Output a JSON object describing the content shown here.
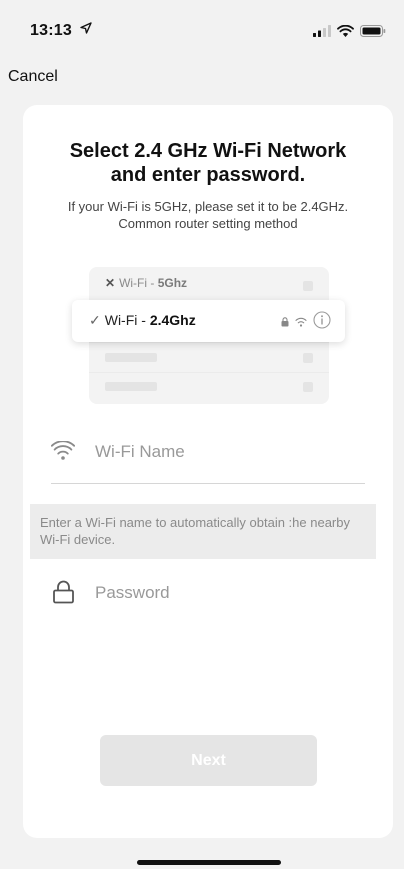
{
  "status_bar": {
    "time": "13:13",
    "icons": [
      "location-arrow-icon",
      "signal-icon",
      "wifi-icon",
      "battery-icon"
    ]
  },
  "nav": {
    "cancel_label": "Cancel"
  },
  "card": {
    "title": "Select 2.4 GHz Wi-Fi Network and enter password.",
    "subtitle_line1": "If your Wi-Fi is 5GHz, please set it to be 2.4GHz.",
    "subtitle_line2": "Common router setting method"
  },
  "illustration": {
    "row_5g": {
      "prefix": "Wi-Fi - ",
      "band": "5Ghz"
    },
    "row_24": {
      "prefix": "Wi-Fi - ",
      "band": "2.4Ghz"
    }
  },
  "form": {
    "wifi_name": {
      "placeholder": "Wi-Fi Name",
      "value": ""
    },
    "hint": "Enter a Wi-Fi name to automatically obtain :he nearby Wi-Fi device.",
    "password": {
      "placeholder": "Password",
      "value": ""
    }
  },
  "actions": {
    "next_label": "Next"
  },
  "colors": {
    "background": "#f2f2f2",
    "card": "#ffffff",
    "button_disabled": "#e5e5e5",
    "hint_bg": "#ececec"
  }
}
